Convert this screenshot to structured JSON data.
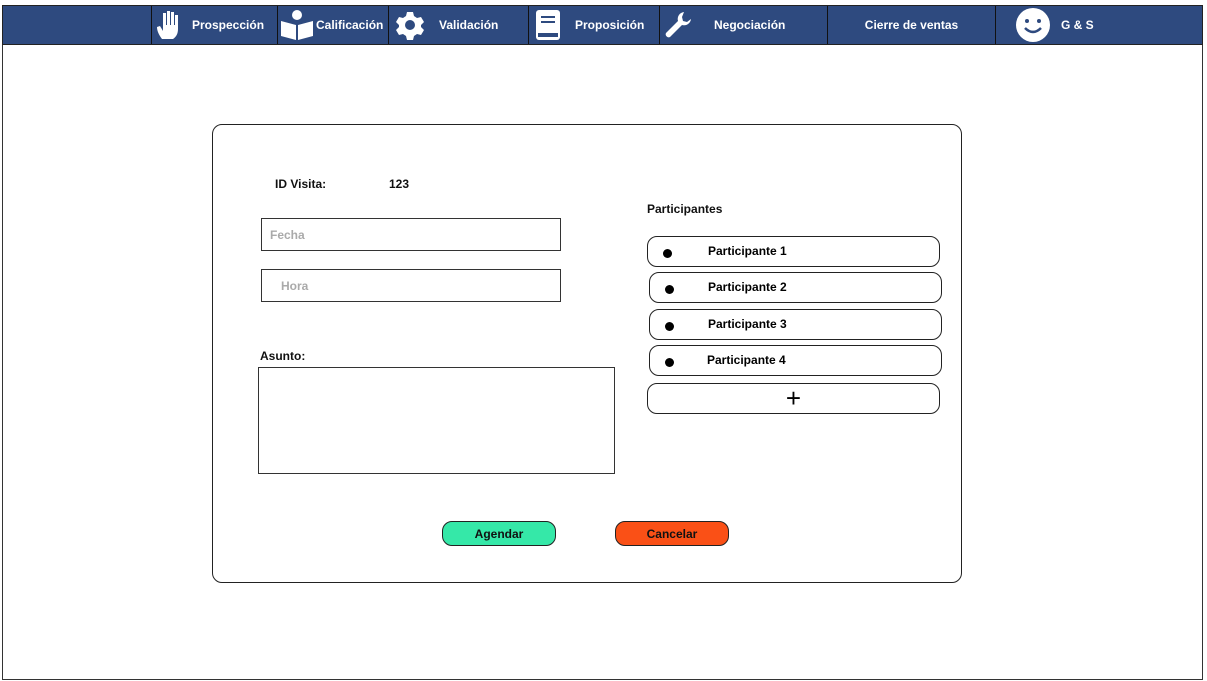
{
  "nav": {
    "items": [
      {
        "label": "Prospección",
        "icon": "hand-icon"
      },
      {
        "label": "Calificación",
        "icon": "reader-icon"
      },
      {
        "label": "Validación",
        "icon": "gear-icon"
      },
      {
        "label": "Proposición",
        "icon": "book-icon"
      },
      {
        "label": "Negociación",
        "icon": "wrench-icon"
      },
      {
        "label": "Cierre de ventas"
      },
      {
        "label": "G & S",
        "icon": "smiley-icon"
      }
    ],
    "color": "#2e4a7f"
  },
  "form": {
    "id_label": "ID Visita:",
    "id_value": "123",
    "fecha_placeholder": "Fecha",
    "hora_placeholder": "Hora",
    "asunto_label": "Asunto:",
    "participants_label": "Participantes",
    "participants": [
      "Participante 1",
      "Participante 2",
      "Participante 3",
      "Participante 4"
    ],
    "add_label": "+",
    "agendar": "Agendar",
    "cancelar": "Cancelar",
    "agendar_color": "#35e8a8",
    "cancelar_color": "#fa5016"
  }
}
